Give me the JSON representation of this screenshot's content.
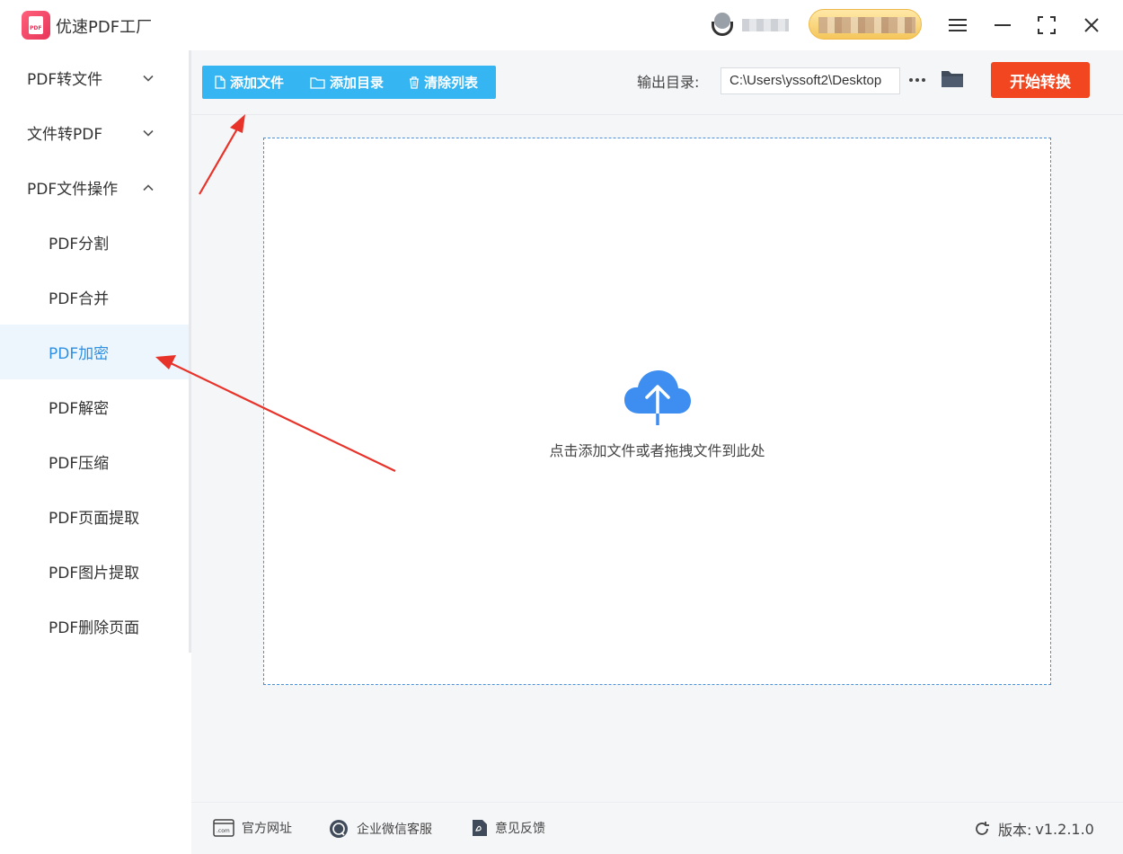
{
  "window": {
    "title": "优速PDF工厂",
    "logo_text": "PDF"
  },
  "sidebar": {
    "groups": [
      {
        "label": "PDF转文件",
        "expanded": false
      },
      {
        "label": "文件转PDF",
        "expanded": false
      },
      {
        "label": "PDF文件操作",
        "expanded": true
      }
    ],
    "sub_items": [
      {
        "label": "PDF分割"
      },
      {
        "label": "PDF合并"
      },
      {
        "label": "PDF加密",
        "active": true
      },
      {
        "label": "PDF解密"
      },
      {
        "label": "PDF压缩"
      },
      {
        "label": "PDF页面提取"
      },
      {
        "label": "PDF图片提取"
      },
      {
        "label": "PDF删除页面"
      }
    ]
  },
  "toolbar": {
    "add_file": "添加文件",
    "add_dir": "添加目录",
    "clear_list": "清除列表",
    "output_label": "输出目录:",
    "output_path": "C:\\Users\\yssoft2\\Desktop",
    "start_label": "开始转换"
  },
  "dropzone": {
    "hint": "点击添加文件或者拖拽文件到此处"
  },
  "footer": {
    "website": "官方网址",
    "wechat": "企业微信客服",
    "feedback": "意见反馈",
    "version_label": "版本:",
    "version_value": "v1.2.1.0"
  },
  "colors": {
    "accent_blue": "#35b6f2",
    "active_blue": "#2f8fe0",
    "start_red": "#f1461f",
    "annotation_red": "#e8332a"
  }
}
